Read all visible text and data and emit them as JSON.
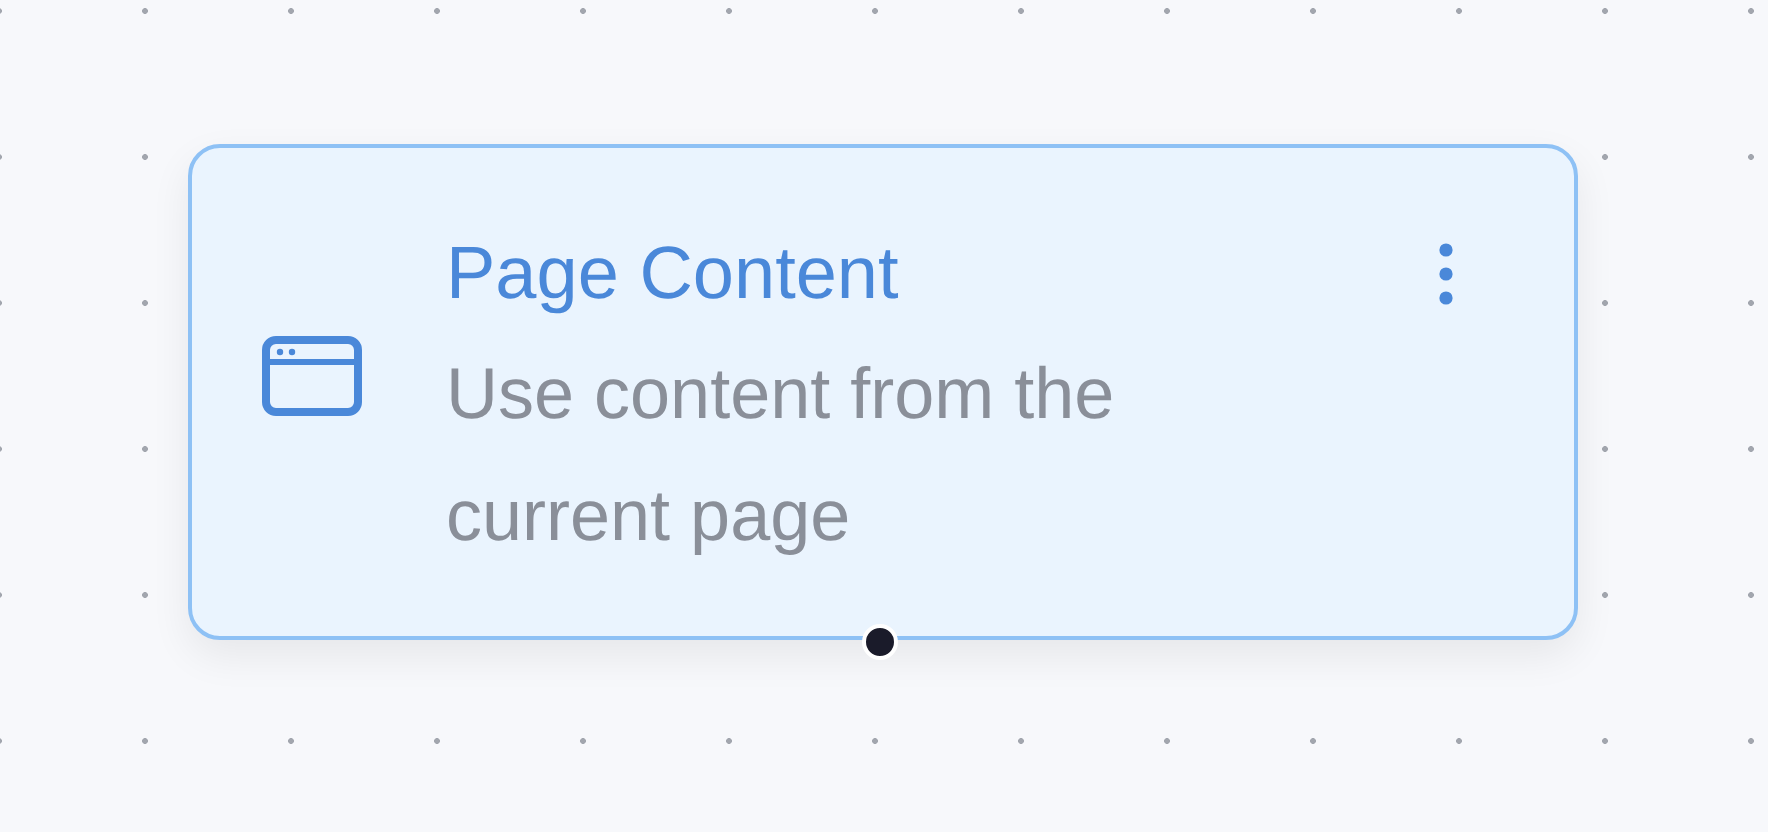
{
  "node": {
    "title": "Page Content",
    "description": "Use content from the current page"
  }
}
